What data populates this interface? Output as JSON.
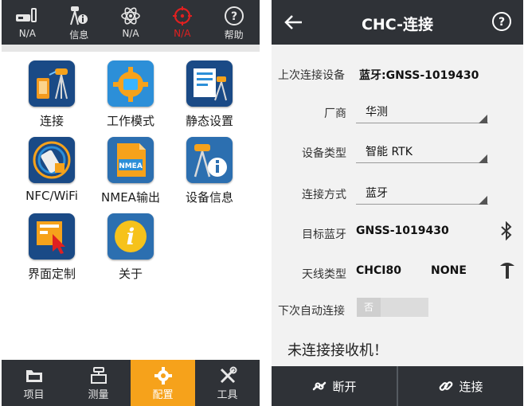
{
  "left": {
    "status": [
      {
        "label": "N/A",
        "icon": "rover-icon"
      },
      {
        "label": "信息",
        "icon": "antenna-info-icon"
      },
      {
        "label": "N/A",
        "icon": "satellite-atom-icon"
      },
      {
        "label": "N/A",
        "icon": "target-icon",
        "color": "#e02020"
      },
      {
        "label": "帮助",
        "icon": "help-icon"
      }
    ],
    "tiles": [
      {
        "label": "连接",
        "icon": "connect-icon"
      },
      {
        "label": "工作模式",
        "icon": "gear-mode-icon"
      },
      {
        "label": "静态设置",
        "icon": "static-settings-icon"
      },
      {
        "label": "NFC/WiFi",
        "icon": "nfc-wifi-icon"
      },
      {
        "label": "NMEA输出",
        "icon": "nmea-output-icon"
      },
      {
        "label": "设备信息",
        "icon": "device-info-icon"
      },
      {
        "label": "界面定制",
        "icon": "ui-customize-icon"
      },
      {
        "label": "关于",
        "icon": "about-icon"
      }
    ],
    "tabs": [
      {
        "label": "项目",
        "icon": "folder-icon",
        "active": false
      },
      {
        "label": "测量",
        "icon": "survey-icon",
        "active": false
      },
      {
        "label": "配置",
        "icon": "config-gear-icon",
        "active": true
      },
      {
        "label": "工具",
        "icon": "tools-icon",
        "active": false
      }
    ],
    "accent": "#f6a21b"
  },
  "right": {
    "title": "CHC-连接",
    "fields": {
      "last_device": {
        "label": "上次连接设备",
        "value": "蓝牙:GNSS-1019430"
      },
      "vendor": {
        "label": "厂商",
        "value": "华测"
      },
      "device_type": {
        "label": "设备类型",
        "value": "智能 RTK"
      },
      "connection": {
        "label": "连接方式",
        "value": "蓝牙"
      },
      "target_bt": {
        "label": "目标蓝牙",
        "value": "GNSS-1019430"
      },
      "antenna": {
        "label": "天线类型",
        "value": "CHCI80",
        "value2": "NONE"
      },
      "auto_connect": {
        "label": "下次自动连接",
        "value": "否"
      }
    },
    "status_note": "未连接接收机！",
    "buttons": {
      "disconnect": "断开",
      "connect": "连接"
    }
  }
}
